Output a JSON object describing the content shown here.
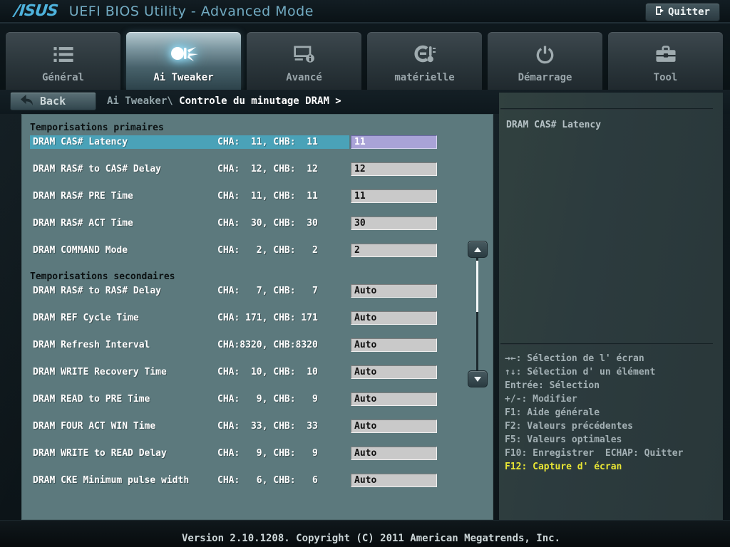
{
  "header": {
    "logo_text": "/ISUS",
    "title": "UEFI BIOS Utility - Advanced Mode",
    "exit_button": "Quitter"
  },
  "tabs": [
    {
      "label": "Général",
      "icon": "list-icon",
      "active": false
    },
    {
      "label": "Ai Tweaker",
      "icon": "comet-icon",
      "active": true
    },
    {
      "label": "Avancé",
      "icon": "monitor-info-icon",
      "active": false
    },
    {
      "label": "matérielle",
      "icon": "gauge-thermometer-icon",
      "active": false
    },
    {
      "label": "Démarrage",
      "icon": "power-icon",
      "active": false
    },
    {
      "label": "Tool",
      "icon": "toolbox-icon",
      "active": false
    }
  ],
  "breadcrumb": {
    "back_label": "Back",
    "path_prefix": "Ai Tweaker\\",
    "path_current": "Controle du minutage DRAM >"
  },
  "main": {
    "sections": [
      {
        "title": "Temporisations primaires",
        "rows": [
          {
            "label": "DRAM CAS# Latency",
            "info": "CHA:  11, CHB:  11",
            "value": "11",
            "selected": true
          },
          {
            "label": "DRAM RAS# to CAS# Delay",
            "info": "CHA:  12, CHB:  12",
            "value": "12"
          },
          {
            "label": "DRAM RAS# PRE Time",
            "info": "CHA:  11, CHB:  11",
            "value": "11"
          },
          {
            "label": "DRAM RAS# ACT Time",
            "info": "CHA:  30, CHB:  30",
            "value": "30"
          },
          {
            "label": "DRAM COMMAND Mode",
            "info": "CHA:   2, CHB:   2",
            "value": "2"
          }
        ]
      },
      {
        "title": "Temporisations secondaires",
        "rows": [
          {
            "label": "DRAM RAS# to RAS# Delay",
            "info": "CHA:   7, CHB:   7",
            "value": "Auto"
          },
          {
            "label": "DRAM REF Cycle Time",
            "info": "CHA: 171, CHB: 171",
            "value": "Auto"
          },
          {
            "label": "DRAM Refresh Interval",
            "info": "CHA:8320, CHB:8320",
            "value": "Auto"
          },
          {
            "label": "DRAM WRITE Recovery Time",
            "info": "CHA:  10, CHB:  10",
            "value": "Auto"
          },
          {
            "label": "DRAM READ to PRE Time",
            "info": "CHA:   9, CHB:   9",
            "value": "Auto"
          },
          {
            "label": "DRAM FOUR ACT WIN Time",
            "info": "CHA:  33, CHB:  33",
            "value": "Auto"
          },
          {
            "label": "DRAM WRITE to READ Delay",
            "info": "CHA:   9, CHB:   9",
            "value": "Auto"
          },
          {
            "label": "DRAM CKE Minimum pulse width",
            "info": "CHA:   6, CHB:   6",
            "value": "Auto"
          }
        ]
      }
    ]
  },
  "help_panel": {
    "title": "DRAM CAS# Latency",
    "shortcuts": [
      {
        "text": "→←: Sélection de l' écran"
      },
      {
        "text": "↑↓: Sélection d' un élément"
      },
      {
        "text": "Entrée: Sélection"
      },
      {
        "text": "+/-: Modifier"
      },
      {
        "text": "F1: Aide générale"
      },
      {
        "text": "F2: Valeurs précédentes"
      },
      {
        "text": "F5: Valeurs optimales"
      },
      {
        "text": "F10: Enregistrer  ECHAP: Quitter"
      },
      {
        "text": "F12: Capture d' écran",
        "highlight": true
      }
    ]
  },
  "footer": {
    "version_text": "Version 2.10.1208. Copyright (C) 2011 American Megatrends, Inc."
  },
  "colors": {
    "selected_row_bg": "#4aa2b8",
    "selected_field_bg": "#a9a3d7",
    "field_bg": "#c9c9c9",
    "main_panel_bg": "#5c797d",
    "right_panel_bg": "#2c3b3e",
    "highlight_shortcut_text": "#e8e534",
    "logo_blue": "#4eb2dc",
    "header_title_blue": "#72abc2"
  }
}
